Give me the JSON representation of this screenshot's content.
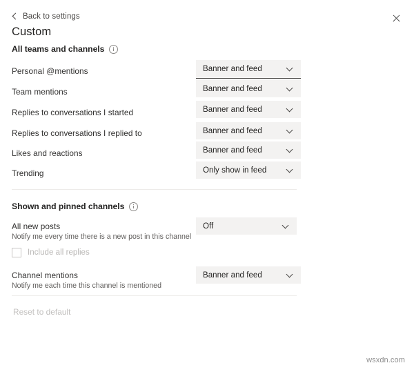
{
  "header": {
    "back_label": "Back to settings",
    "back_icon": "chevron-left-icon",
    "close_icon": "close-icon",
    "title": "Custom"
  },
  "sections": [
    {
      "heading": "All teams and channels",
      "info_icon": "info-circle-icon",
      "rows": [
        {
          "label": "Personal @mentions",
          "value": "Banner and feed",
          "focused": true
        },
        {
          "label": "Team mentions",
          "value": "Banner and feed",
          "focused": false
        },
        {
          "label": "Replies to conversations I started",
          "value": "Banner and feed",
          "focused": false
        },
        {
          "label": "Replies to conversations I replied to",
          "value": "Banner and feed",
          "focused": false
        },
        {
          "label": "Likes and reactions",
          "value": "Banner and feed",
          "focused": false
        },
        {
          "label": "Trending",
          "value": "Only show in feed",
          "focused": false
        }
      ]
    },
    {
      "heading": "Shown and pinned channels",
      "info_icon": "info-circle-icon",
      "rows": [
        {
          "label": "All new posts",
          "sub": "Notify me every time there is a new post in this channel",
          "value": "Off",
          "focused": false
        },
        {
          "label": "Channel mentions",
          "sub": "Notify me each time this channel is mentioned",
          "value": "Banner and feed",
          "focused": false
        }
      ],
      "checkbox": {
        "label": "Include all replies",
        "checked": false,
        "disabled": true
      }
    }
  ],
  "footer": {
    "reset_label": "Reset to default"
  },
  "watermark": "wsxdn.com",
  "dropdown_options": [
    "Banner and feed",
    "Only show in feed",
    "Off"
  ],
  "colors": {
    "dropdown_bg": "#f3f2f1",
    "divider": "#edebe9",
    "text_primary": "#252423",
    "text_secondary": "#605e5c",
    "text_disabled": "#b9b7b5"
  }
}
